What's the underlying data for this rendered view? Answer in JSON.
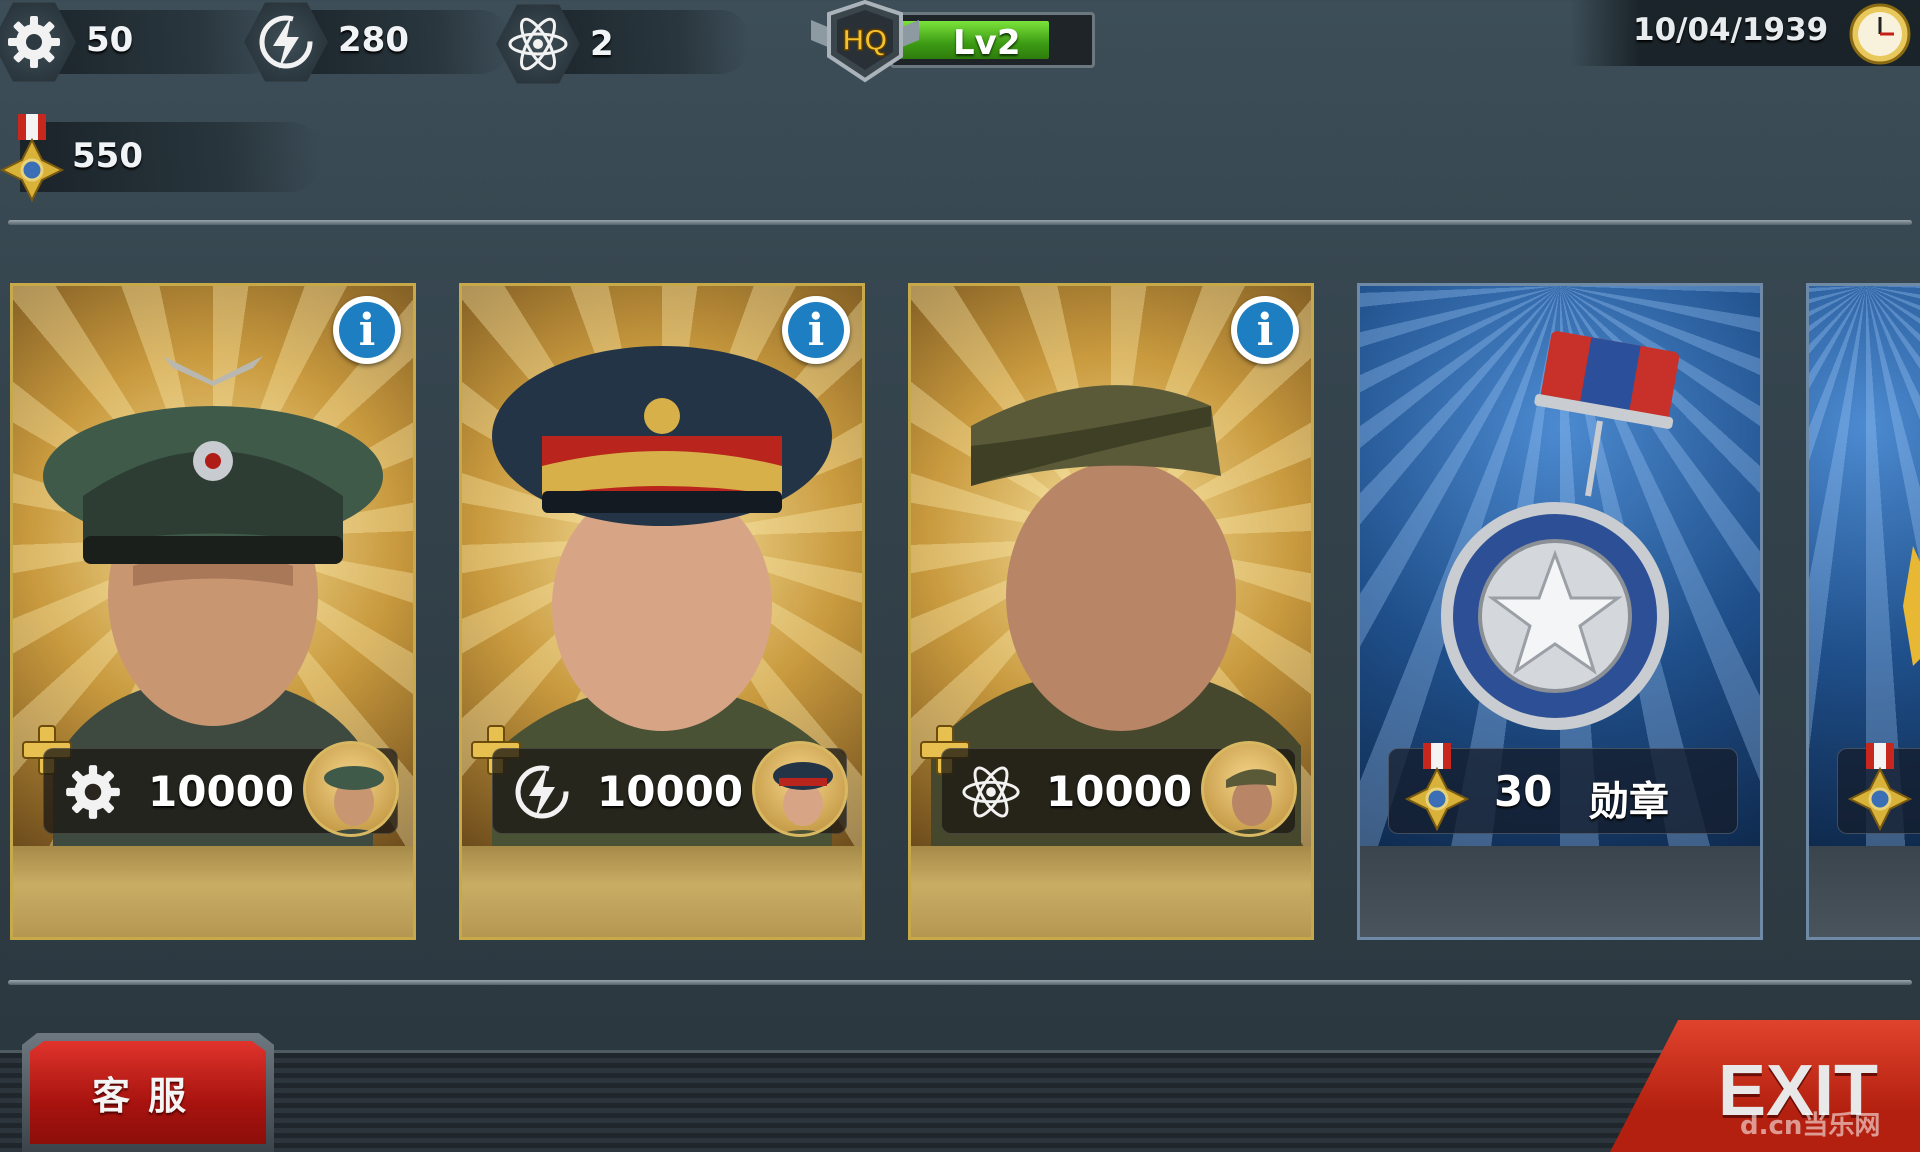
{
  "resources": {
    "gear": {
      "icon": "gear-icon",
      "value": "50"
    },
    "energy": {
      "icon": "lightning-icon",
      "value": "280"
    },
    "tech": {
      "icon": "atom-icon",
      "value": "2"
    },
    "medals": {
      "icon": "medal-icon",
      "value": "550"
    }
  },
  "hq": {
    "badge": "HQ",
    "level": "Lv2"
  },
  "date": "10/04/1939",
  "cards": [
    {
      "icon": "gear-icon",
      "price": "10000"
    },
    {
      "icon": "lightning-icon",
      "price": "10000"
    },
    {
      "icon": "atom-icon",
      "price": "10000"
    },
    {
      "icon": "medal-icon",
      "price": "30",
      "label": "勋章"
    }
  ],
  "buttons": {
    "customer_service": "客服",
    "exit": "EXIT"
  },
  "watermark": "d.cn当乐网",
  "colors": {
    "accent_red": "#c41f17",
    "gold": "#c7a94a",
    "hq_green": "#3c9a14",
    "info_blue": "#1d7fc2"
  }
}
